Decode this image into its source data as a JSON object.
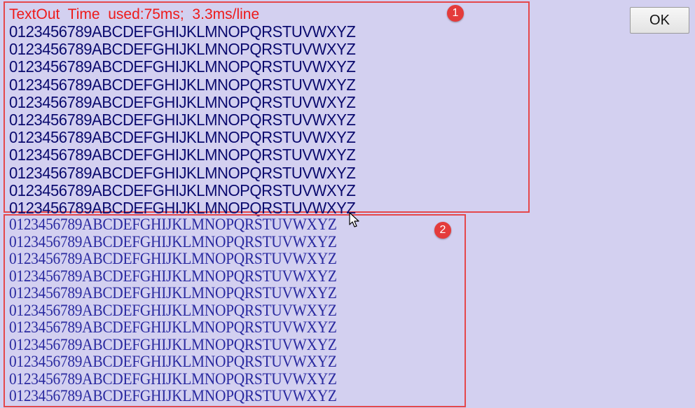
{
  "panel1": {
    "badge": "1",
    "title": "TextOut  Time  used:75ms;  3.3ms/line",
    "lines": [
      "0123456789ABCDEFGHIJKLMNOPQRSTUVWXYZ",
      "0123456789ABCDEFGHIJKLMNOPQRSTUVWXYZ",
      "0123456789ABCDEFGHIJKLMNOPQRSTUVWXYZ",
      "0123456789ABCDEFGHIJKLMNOPQRSTUVWXYZ",
      "0123456789ABCDEFGHIJKLMNOPQRSTUVWXYZ",
      "0123456789ABCDEFGHIJKLMNOPQRSTUVWXYZ",
      "0123456789ABCDEFGHIJKLMNOPQRSTUVWXYZ",
      "0123456789ABCDEFGHIJKLMNOPQRSTUVWXYZ",
      "0123456789ABCDEFGHIJKLMNOPQRSTUVWXYZ",
      "0123456789ABCDEFGHIJKLMNOPQRSTUVWXYZ",
      "0123456789ABCDEFGHIJKLMNOPQRSTUVWXYZ"
    ]
  },
  "panel2": {
    "badge": "2",
    "lines": [
      "0123456789ABCDEFGHIJKLMNOPQRSTUVWXYZ",
      "0123456789ABCDEFGHIJKLMNOPQRSTUVWXYZ",
      "0123456789ABCDEFGHIJKLMNOPQRSTUVWXYZ",
      "0123456789ABCDEFGHIJKLMNOPQRSTUVWXYZ",
      "0123456789ABCDEFGHIJKLMNOPQRSTUVWXYZ",
      "0123456789ABCDEFGHIJKLMNOPQRSTUVWXYZ",
      "0123456789ABCDEFGHIJKLMNOPQRSTUVWXYZ",
      "0123456789ABCDEFGHIJKLMNOPQRSTUVWXYZ",
      "0123456789ABCDEFGHIJKLMNOPQRSTUVWXYZ",
      "0123456789ABCDEFGHIJKLMNOPQRSTUVWXYZ",
      "0123456789ABCDEFGHIJKLMNOPQRSTUVWXYZ"
    ]
  },
  "ok_button": {
    "label": "OK"
  },
  "colors": {
    "background": "#d3d0f0",
    "highlight_border": "#e5474b",
    "title_text": "#ee1a1a",
    "sans_text": "#0a0a6e",
    "serif_text": "#2a2aa0",
    "badge": "#e43b3b"
  },
  "icons": {
    "cursor": "mouse-pointer-icon"
  }
}
